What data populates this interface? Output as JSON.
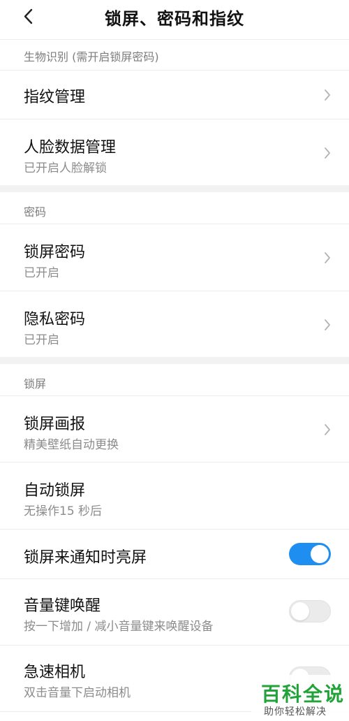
{
  "header": {
    "title": "锁屏、密码和指纹"
  },
  "sections": [
    {
      "label": "生物识别 (需开启锁屏密码)",
      "items": [
        {
          "title": "指纹管理",
          "subtitle": ""
        },
        {
          "title": "人脸数据管理",
          "subtitle": "已开启人脸解锁"
        }
      ]
    },
    {
      "label": "密码",
      "items": [
        {
          "title": "锁屏密码",
          "subtitle": "已开启"
        },
        {
          "title": "隐私密码",
          "subtitle": "已开启"
        }
      ]
    },
    {
      "label": "锁屏",
      "items": [
        {
          "title": "锁屏画报",
          "subtitle": "精美壁纸自动更换"
        },
        {
          "title": "自动锁屏",
          "subtitle": "无操作15 秒后"
        },
        {
          "title": "锁屏来通知时亮屏",
          "subtitle": "",
          "toggle": true
        },
        {
          "title": "音量键唤醒",
          "subtitle": "按一下增加 / 减小音量键来唤醒设备",
          "toggle": false
        },
        {
          "title": "急速相机",
          "subtitle": "双击音量下启动相机",
          "toggle": false
        }
      ]
    }
  ],
  "watermark": {
    "main": "百科全说",
    "sub": "助你轻松解决"
  },
  "colors": {
    "accent": "#1f8ef1",
    "watermark": "#21a33a"
  }
}
